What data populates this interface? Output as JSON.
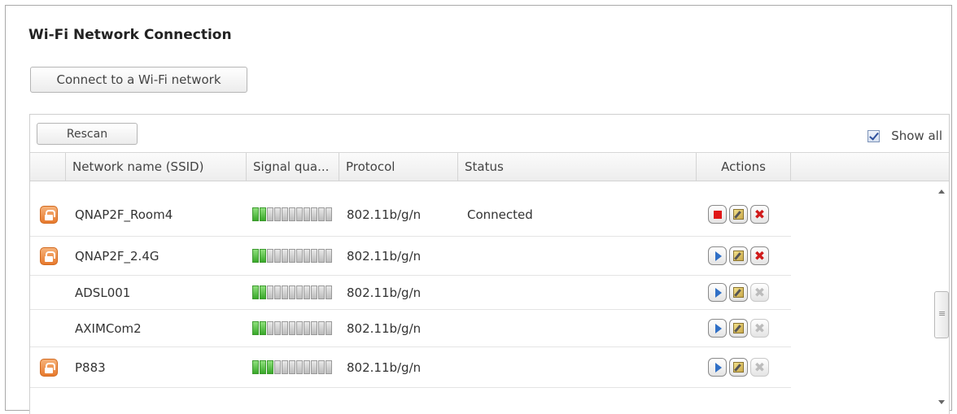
{
  "window": {
    "title": "Wi-Fi Network Connection"
  },
  "toolbar": {
    "connect_label": "Connect to a Wi-Fi network"
  },
  "grid": {
    "rescan_label": "Rescan",
    "show_all_label": "Show all",
    "show_all_checked": true,
    "columns": [
      "Network name (SSID)",
      "Signal qua...",
      "Protocol",
      "Status",
      "Actions"
    ],
    "rows": [
      {
        "ssid": "QNAP2F_Room4",
        "secured": true,
        "signal_bars": 2,
        "protocol": "802.11b/g/n",
        "status": "Connected",
        "primary_action": "stop",
        "delete_enabled": true
      },
      {
        "ssid": "QNAP2F_2.4G",
        "secured": true,
        "signal_bars": 2,
        "protocol": "802.11b/g/n",
        "status": "",
        "primary_action": "connect",
        "delete_enabled": true
      },
      {
        "ssid": "ADSL001",
        "secured": false,
        "signal_bars": 2,
        "protocol": "802.11b/g/n",
        "status": "",
        "primary_action": "connect",
        "delete_enabled": false
      },
      {
        "ssid": "AXIMCom2",
        "secured": false,
        "signal_bars": 2,
        "protocol": "802.11b/g/n",
        "status": "",
        "primary_action": "connect",
        "delete_enabled": false
      },
      {
        "ssid": "P883",
        "secured": true,
        "signal_bars": 3,
        "protocol": "802.11b/g/n",
        "status": "",
        "primary_action": "connect",
        "delete_enabled": false
      }
    ]
  },
  "colors": {
    "accent": "#e77a2e",
    "signal_on": "#39a82a",
    "delete_active": "#d01b1b",
    "stop": "#e01818",
    "play": "#2f6fc6"
  }
}
